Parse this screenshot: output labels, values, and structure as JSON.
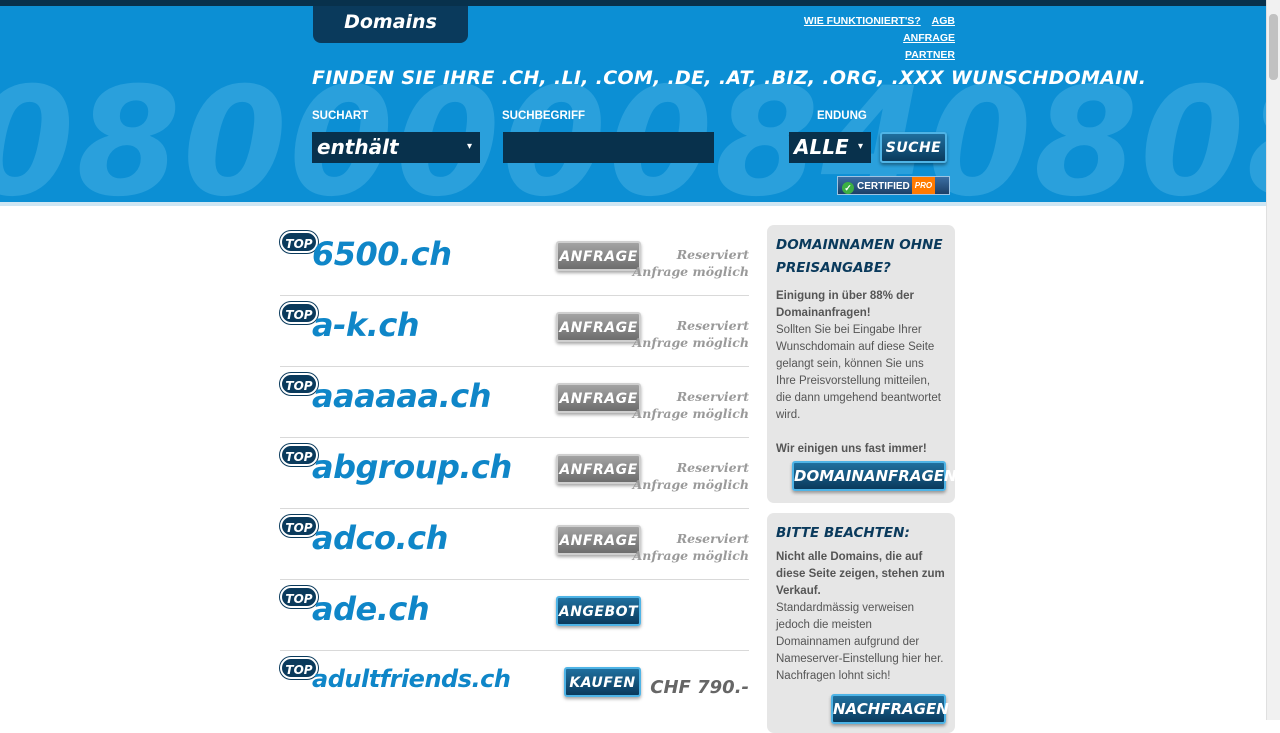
{
  "header": {
    "tab_label": "Domains",
    "links": [
      "WIE FUNKTIONIERT'S?",
      "AGB",
      "ANFRAGE",
      "PARTNER"
    ],
    "tagline": "FINDEN SIE IHRE .CH, .LI, .COM, .DE, .AT, .BIZ, .ORG, .XXX WUNSCHDOMAIN.",
    "background_digits": "08000008408080",
    "colors": {
      "header_bg": "#0c8fd4",
      "dark": "#0a3a5c",
      "domain_blue": "#0f86c8"
    }
  },
  "search": {
    "suchart_label": "SUCHART",
    "suchart_value": "enthält",
    "suchbegriff_label": "SUCHBEGRIFF",
    "suchbegriff_value": "",
    "endung_label": "ENDUNG",
    "endung_value": "ALLE",
    "search_button": "SUCHE",
    "caret_icon": "▾"
  },
  "certified_badge": {
    "label": "CERTIFIED",
    "pro": "PRO",
    "check_icon": "✓"
  },
  "domains": [
    {
      "badge": "TOP",
      "name": "6500.ch",
      "action": "ANFRAGE",
      "status1": "Reserviert",
      "status2": "Anfrage möglich"
    },
    {
      "badge": "TOP",
      "name": "a-k.ch",
      "action": "ANFRAGE",
      "status1": "Reserviert",
      "status2": "Anfrage möglich"
    },
    {
      "badge": "TOP",
      "name": "aaaaaa.ch",
      "action": "ANFRAGE",
      "status1": "Reserviert",
      "status2": "Anfrage möglich"
    },
    {
      "badge": "TOP",
      "name": "abgroup.ch",
      "action": "ANFRAGE",
      "status1": "Reserviert",
      "status2": "Anfrage möglich"
    },
    {
      "badge": "TOP",
      "name": "adco.ch",
      "action": "ANFRAGE",
      "status1": "Reserviert",
      "status2": "Anfrage möglich"
    },
    {
      "badge": "TOP",
      "name": "ade.ch",
      "action": "ANGEBOT"
    },
    {
      "badge": "TOP",
      "name": "adultfriends.ch",
      "action": "KAUFEN",
      "price": "CHF 790.-"
    }
  ],
  "sidebar": {
    "box1": {
      "title": "DOMAINNAMEN OHNE PREISANGABE?",
      "intro": "Einigung in über 88% der Domainanfragen!",
      "body": "Sollten Sie bei Eingabe Ihrer Wunschdomain auf diese Seite gelangt sein, können Sie uns Ihre Preisvorstellung mitteilen, die dann umgehend beantwortet wird.",
      "closing": "Wir einigen uns fast immer!",
      "button": "DOMAINANFRAGEN"
    },
    "box2": {
      "title": "BITTE BEACHTEN:",
      "intro": "Nicht alle Domains, die auf diese Seite zeigen, stehen zum Verkauf.",
      "body": "Standardmässig verweisen jedoch die meisten Domainnamen aufgrund der Nameserver-Einstellung hier her. Nachfragen lohnt sich!",
      "button": "NACHFRAGEN"
    }
  }
}
